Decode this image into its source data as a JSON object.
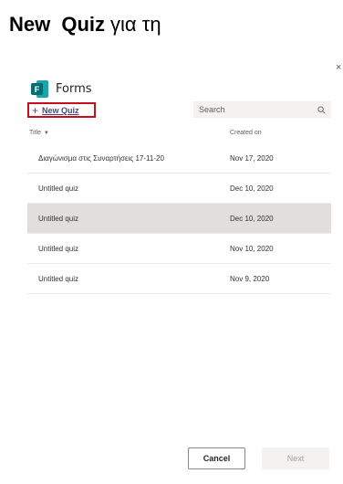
{
  "heading": {
    "bold": "New Quiz",
    "rest": "για τη"
  },
  "close_glyph": "×",
  "app": {
    "name": "Forms",
    "logo_letter": "F",
    "logo_color": "#036c70"
  },
  "toolbar": {
    "new_quiz_plus": "+",
    "new_quiz_label": "New Quiz",
    "highlight_color": "#c50f1f"
  },
  "search": {
    "placeholder": "Search"
  },
  "table": {
    "col_title": "Title",
    "col_title_sort": "▼",
    "col_created": "Created on",
    "rows": [
      {
        "title": "Διαγώνισμα στις Συναρτήσεις 17-11-20",
        "created": "Nov 17, 2020",
        "selected": false
      },
      {
        "title": "Untitled quiz",
        "created": "Dec 10, 2020",
        "selected": false
      },
      {
        "title": "Untitled quiz",
        "created": "Dec 10, 2020",
        "selected": true
      },
      {
        "title": "Untitled quiz",
        "created": "Nov 10, 2020",
        "selected": false
      },
      {
        "title": "Untitled quiz",
        "created": "Nov 9, 2020",
        "selected": false
      }
    ]
  },
  "footer": {
    "cancel_label": "Cancel",
    "next_label": "Next"
  }
}
